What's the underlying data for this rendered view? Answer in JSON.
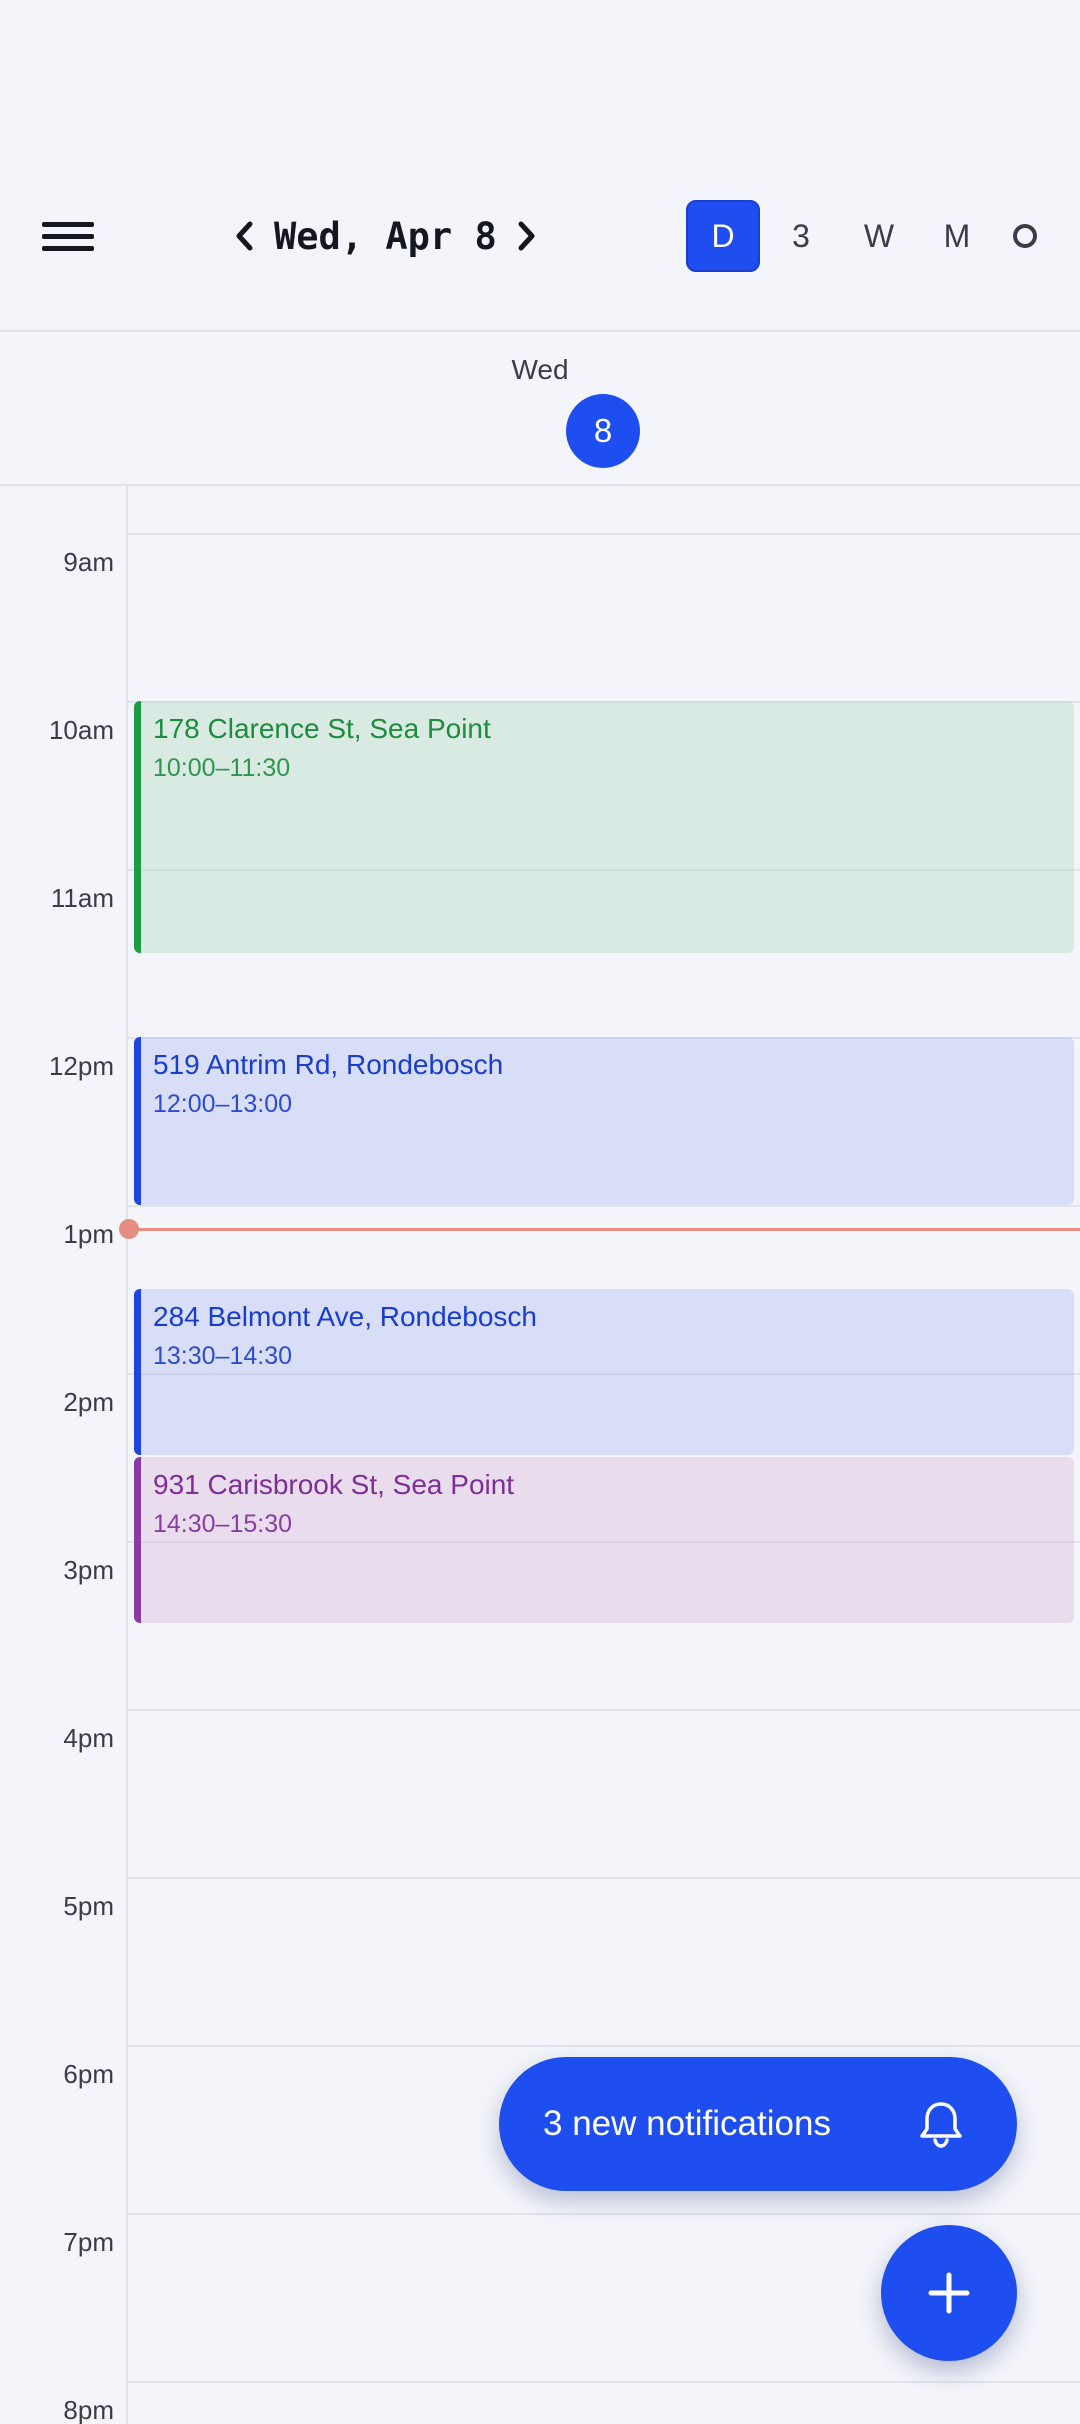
{
  "header": {
    "date_label": "Wed, Apr 8",
    "views": [
      {
        "label": "D",
        "active": true
      },
      {
        "label": "3",
        "active": false
      },
      {
        "label": "W",
        "active": false
      },
      {
        "label": "M",
        "active": false
      },
      {
        "icon": "circle-icon",
        "active": false
      }
    ]
  },
  "day": {
    "name": "Wed",
    "number": "8"
  },
  "hours": [
    "9am",
    "10am",
    "11am",
    "12pm",
    "1pm",
    "2pm",
    "3pm",
    "4pm",
    "5pm",
    "6pm",
    "7pm",
    "8pm"
  ],
  "events": [
    {
      "title": "178 Clarence St, Sea Point",
      "time": "10:00–11:30",
      "color": "#1f9a46"
    },
    {
      "title": "519 Antrim Rd, Rondebosch",
      "time": "12:00–13:00",
      "color": "#1f45e0"
    },
    {
      "title": "284 Belmont Ave, Rondebosch",
      "time": "13:30–14:30",
      "color": "#1f45e0"
    },
    {
      "title": "931 Carisbrook St, Sea Point",
      "time": "14:30–15:30",
      "color": "#8a3aa6"
    }
  ],
  "notifications": {
    "label": "3 new notifications",
    "icon": "bell-icon"
  },
  "fab": {
    "icon": "plus-icon"
  },
  "colors": {
    "accent": "#1f4ef0",
    "now_indicator": "#e58d80",
    "background": "#f4f5fa"
  }
}
